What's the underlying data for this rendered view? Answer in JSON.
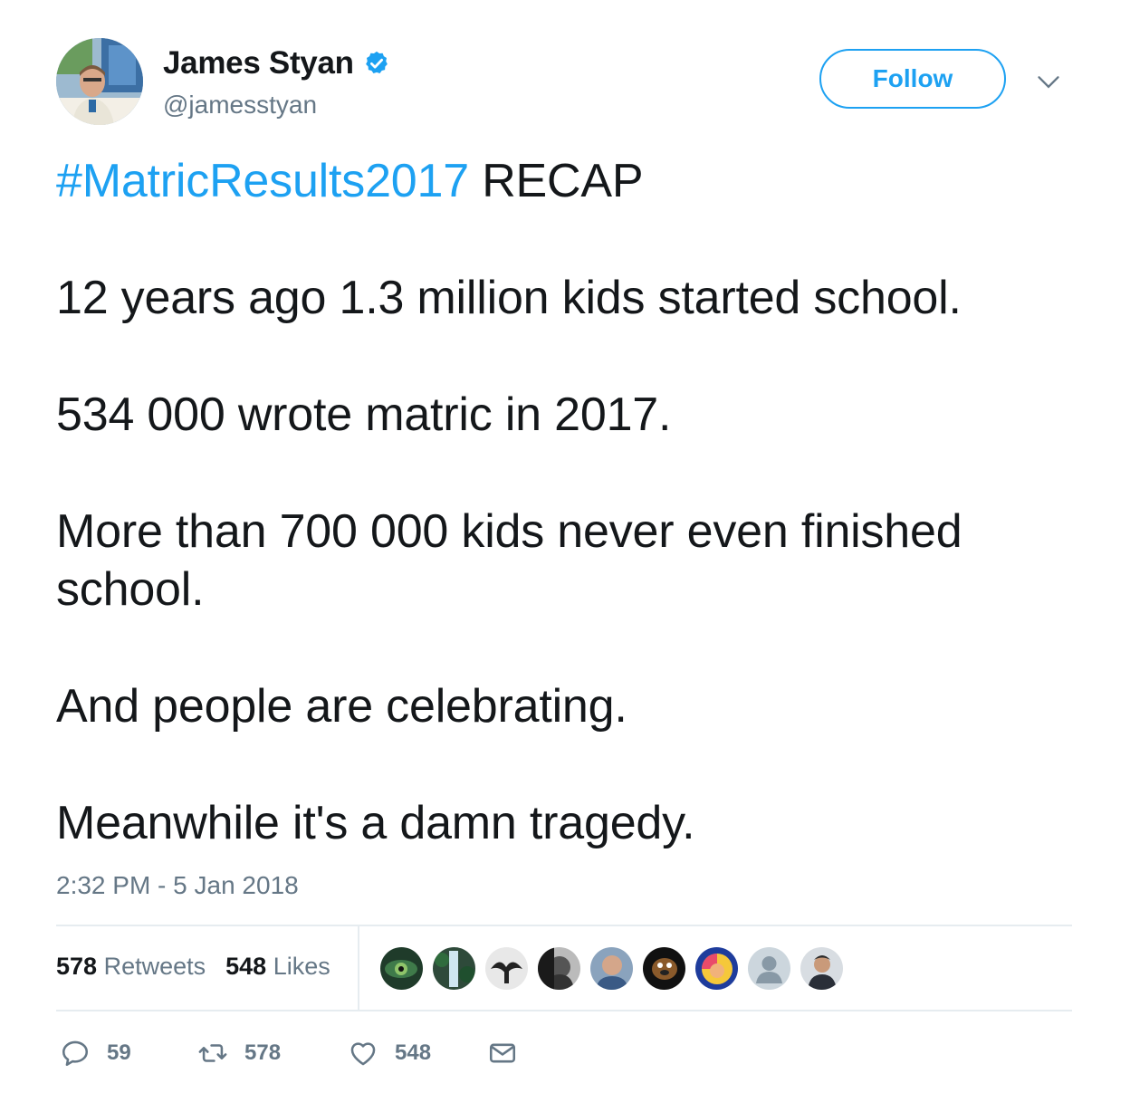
{
  "user": {
    "name": "James Styan",
    "handle": "@jamesstyan",
    "verified": true
  },
  "header": {
    "follow_label": "Follow",
    "accent_color": "#1da1f2"
  },
  "tweet": {
    "hashtag": "#MatricResults2017",
    "line1_rest": " RECAP",
    "line2": "12 years ago 1.3 million kids started school.",
    "line3": "534 000 wrote matric in 2017.",
    "line4": "More than 700 000 kids never even finished school.",
    "line5": "And people are celebrating.",
    "line6": "Meanwhile it's a damn tragedy.",
    "timestamp": "2:32 PM - 5 Jan 2018"
  },
  "stats": {
    "retweets_count": "578",
    "retweets_label": "Retweets",
    "likes_count": "548",
    "likes_label": "Likes"
  },
  "likers": [
    "eye-avatar",
    "waterfall-avatar",
    "bird-avatar",
    "bw-portrait-avatar",
    "man-avatar",
    "scooby-avatar",
    "cartoon-avatar",
    "default-avatar",
    "man-suit-avatar"
  ],
  "actions": {
    "reply_count": "59",
    "retweet_count": "578",
    "like_count": "548"
  }
}
